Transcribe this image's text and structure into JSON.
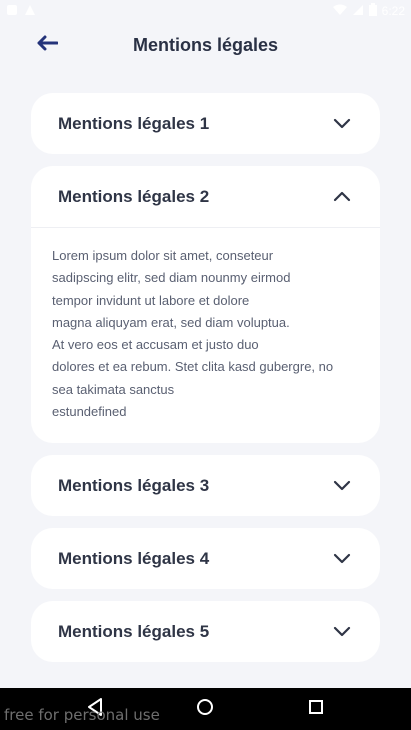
{
  "status": {
    "time": "6:22"
  },
  "header": {
    "title": "Mentions légales"
  },
  "sections": [
    {
      "title": "Mentions légales 1",
      "expanded": false
    },
    {
      "title": "Mentions légales 2",
      "expanded": true,
      "body": "Lorem ipsum dolor sit amet, conseteur\nsadipscing elitr, sed diam nounmy eirmod\ntempor invidunt ut labore et dolore\nmagna aliquyam erat, sed diam voluptua.\nAt vero eos et accusam et justo duo\ndolores et ea rebum. Stet clita kasd gubergre, no\nsea takimata sanctus\nestundefined"
    },
    {
      "title": "Mentions légales 3",
      "expanded": false
    },
    {
      "title": "Mentions légales 4",
      "expanded": false
    },
    {
      "title": "Mentions légales 5",
      "expanded": false
    }
  ],
  "footer": {
    "watermark": "free for personal use"
  },
  "colors": {
    "accent": "#24337a",
    "background": "#f4f5f9",
    "card": "#ffffff",
    "title": "#2f3546"
  },
  "icons": [
    "back-arrow-icon",
    "chevron-down-icon",
    "chevron-up-icon",
    "nav-back-icon",
    "nav-home-icon",
    "nav-recents-icon"
  ]
}
